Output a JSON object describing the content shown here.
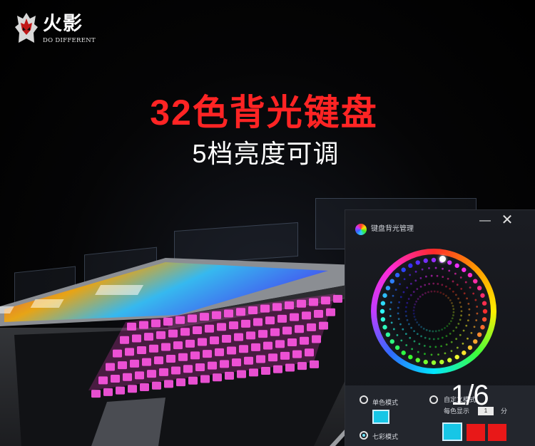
{
  "brand": {
    "name": "火影",
    "tagline": "DO DIFFERENT"
  },
  "headline": {
    "title": "32色背光键盘",
    "subtitle": "5档亮度可调"
  },
  "panel": {
    "title": "键盘背光管理",
    "minimize_glyph": "—",
    "close_glyph": "✕",
    "modes": [
      {
        "label": "单色模式",
        "selected": false
      },
      {
        "label": "自定义模式",
        "selected": false
      },
      {
        "label": "七彩模式",
        "selected": true
      }
    ],
    "speed_label": "每色显示",
    "speed_value": "1",
    "speed_unit": "分"
  },
  "colors": {
    "accent_red": "#ff2424",
    "cyan": "#17c6e6",
    "red_swatch": "#e81818",
    "keyboard_glow": "#ff3ad0"
  },
  "pager": {
    "text": "1/6"
  }
}
